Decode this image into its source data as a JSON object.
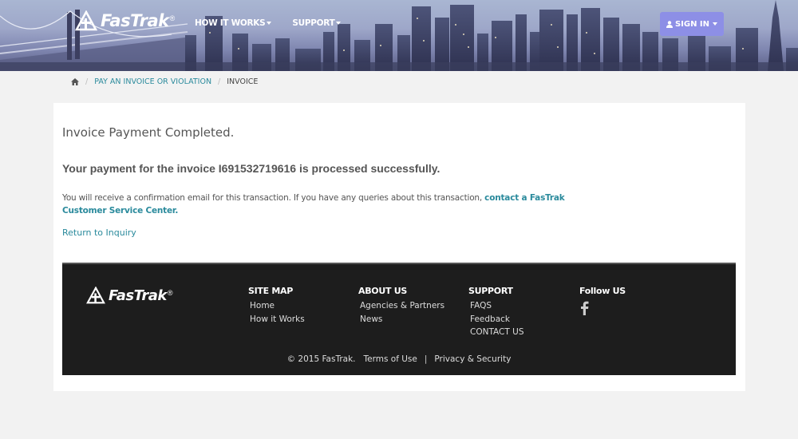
{
  "header": {
    "brand": "FasTrak",
    "brand_mark": "®",
    "nav": [
      {
        "label": "HOW IT WORKS"
      },
      {
        "label": "SUPPORT"
      }
    ],
    "signin_label": "SIGN IN"
  },
  "breadcrumb": {
    "home_icon": "home-icon",
    "items": [
      {
        "label": "PAY AN INVOICE OR VIOLATION"
      },
      {
        "label": "INVOICE"
      }
    ]
  },
  "main": {
    "title": "Invoice Payment Completed.",
    "message": "Your payment for the invoice I691532719616 is processed successfully.",
    "info_text": "You will receive a confirmation email for this transaction. If you have any queries about this transaction, ",
    "info_link": "contact a FasTrak Customer Service Center",
    "info_end": ".",
    "return_link": "Return to Inquiry"
  },
  "footer": {
    "brand": "FasTrak",
    "brand_mark": "®",
    "columns": [
      {
        "heading": "SITE MAP",
        "items": [
          "Home",
          "How it Works"
        ]
      },
      {
        "heading": "ABOUT US",
        "items": [
          "Agencies & Partners",
          "News"
        ]
      },
      {
        "heading": "SUPPORT",
        "items": [
          "FAQS",
          "Feedback",
          "CONTACT US"
        ]
      },
      {
        "heading": "Follow US",
        "items": []
      }
    ],
    "social_icon": "facebook-icon",
    "copyright": "© 2015 FasTrak.",
    "terms": "Terms of Use",
    "separator": "|",
    "privacy": "Privacy & Security"
  },
  "colors": {
    "accent": "#2a8a9c",
    "signin_bg": "#8d8fe6",
    "footer_bg": "#1d1d1d",
    "page_bg": "#f2f2f2"
  }
}
